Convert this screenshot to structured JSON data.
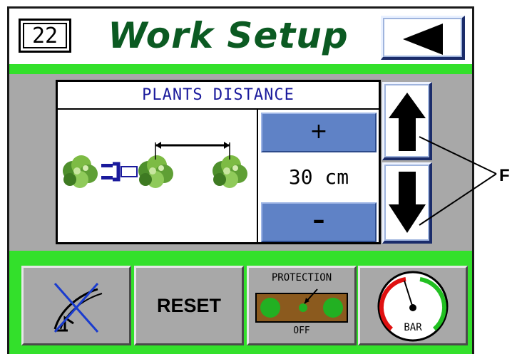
{
  "header": {
    "page_number": "22",
    "title": "Work Setup",
    "back_icon": "back-arrow-icon"
  },
  "setting": {
    "title": "PLANTS DISTANCE",
    "plus_label": "+",
    "minus_label": "–",
    "value": "30 cm",
    "up_icon": "arrow-up-icon",
    "down_icon": "arrow-down-icon"
  },
  "bottom": {
    "reset_label": "RESET",
    "protection_label": "PROTECTION",
    "protection_state": "OFF",
    "gauge_label": "BAR"
  },
  "callout": {
    "label": "F"
  },
  "colors": {
    "panel": "#a8a8a8",
    "green": "#33e02b",
    "title": "#0b5a22",
    "button_blue": "#5f82c6",
    "setting_title": "#1a1a9c"
  }
}
